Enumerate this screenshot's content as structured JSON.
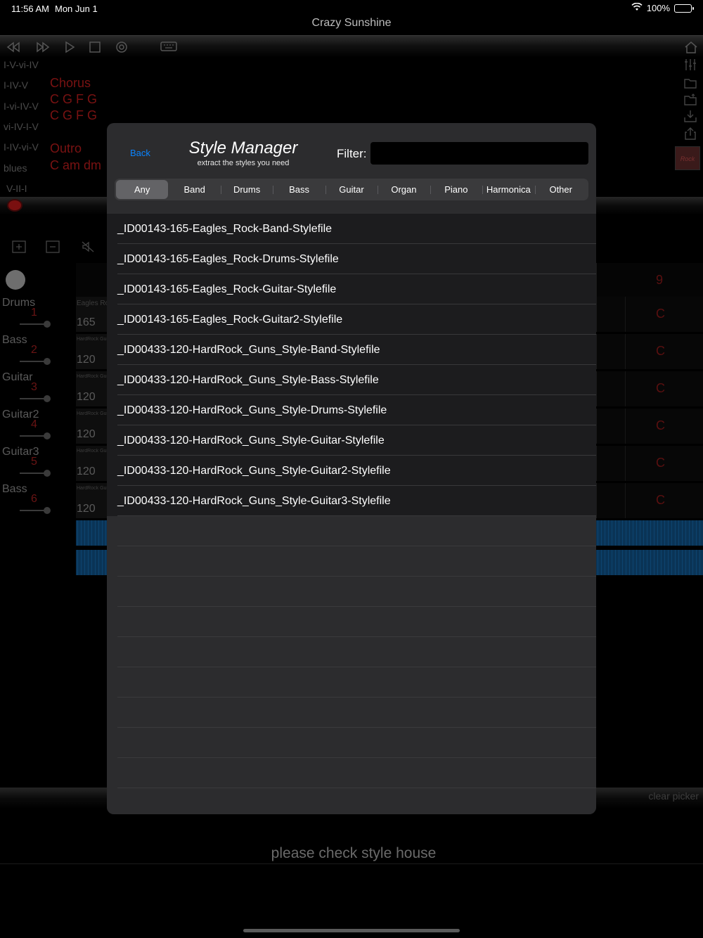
{
  "status": {
    "time": "11:56 AM",
    "date": "Mon Jun 1",
    "battery": "100%"
  },
  "song_title": "Crazy Sunshine",
  "progressions": [
    "I-V-vi-IV",
    "I-IV-V",
    "I-vi-IV-V",
    "vi-IV-I-V",
    "I-IV-vi-V",
    "blues",
    "V-II-I"
  ],
  "sections": [
    {
      "label": "Chorus",
      "color": "#7a1212"
    },
    {
      "label": "C G F G",
      "color": "#7a1212"
    },
    {
      "label": "C G F G",
      "color": "#7a1212"
    },
    {
      "label": "Outro",
      "color": "#7a1212"
    },
    {
      "label": "C am dm",
      "color": "#7a1212"
    }
  ],
  "rock_thumb": "Rock",
  "header_right_num": "9",
  "tracks": [
    {
      "name": "Drums",
      "num": "1",
      "style": "Eagles Rock",
      "bpm": "165",
      "chord": "C"
    },
    {
      "name": "Bass",
      "num": "2",
      "style": "HardRock Guns",
      "bpm": "120",
      "chord": "C"
    },
    {
      "name": "Guitar",
      "num": "3",
      "style": "HardRock Guns",
      "bpm": "120",
      "chord": "C"
    },
    {
      "name": "Guitar2",
      "num": "4",
      "style": "HardRock Guns",
      "bpm": "120",
      "chord": "C"
    },
    {
      "name": "Guitar3",
      "num": "5",
      "style": "HardRock Guns",
      "bpm": "120",
      "chord": "C"
    },
    {
      "name": "Bass",
      "num": "6",
      "style": "HardRock Guns",
      "bpm": "120",
      "chord": "C"
    }
  ],
  "clear_picker": "clear picker",
  "footer_message": "please check style house",
  "modal": {
    "back": "Back",
    "title": "Style Manager",
    "subtitle": "extract the styles you need",
    "filter_label": "Filter:",
    "filter_value": "",
    "filter_placeholder": "",
    "segments": [
      "Any",
      "Band",
      "Drums",
      "Bass",
      "Guitar",
      "Organ",
      "Piano",
      "Harmonica",
      "Other"
    ],
    "selected_segment": "Any",
    "styles": [
      "_ID00143-165-Eagles_Rock-Band-Stylefile",
      "_ID00143-165-Eagles_Rock-Drums-Stylefile",
      "_ID00143-165-Eagles_Rock-Guitar-Stylefile",
      "_ID00143-165-Eagles_Rock-Guitar2-Stylefile",
      "_ID00433-120-HardRock_Guns_Style-Band-Stylefile",
      "_ID00433-120-HardRock_Guns_Style-Bass-Stylefile",
      "_ID00433-120-HardRock_Guns_Style-Drums-Stylefile",
      "_ID00433-120-HardRock_Guns_Style-Guitar-Stylefile",
      "_ID00433-120-HardRock_Guns_Style-Guitar2-Stylefile",
      "_ID00433-120-HardRock_Guns_Style-Guitar3-Stylefile"
    ]
  },
  "colors": {
    "accent": "#0a84ff",
    "modal_bg": "#2c2c2e",
    "row_bg": "#1c1c1e",
    "chord_red": "#7a1212"
  }
}
